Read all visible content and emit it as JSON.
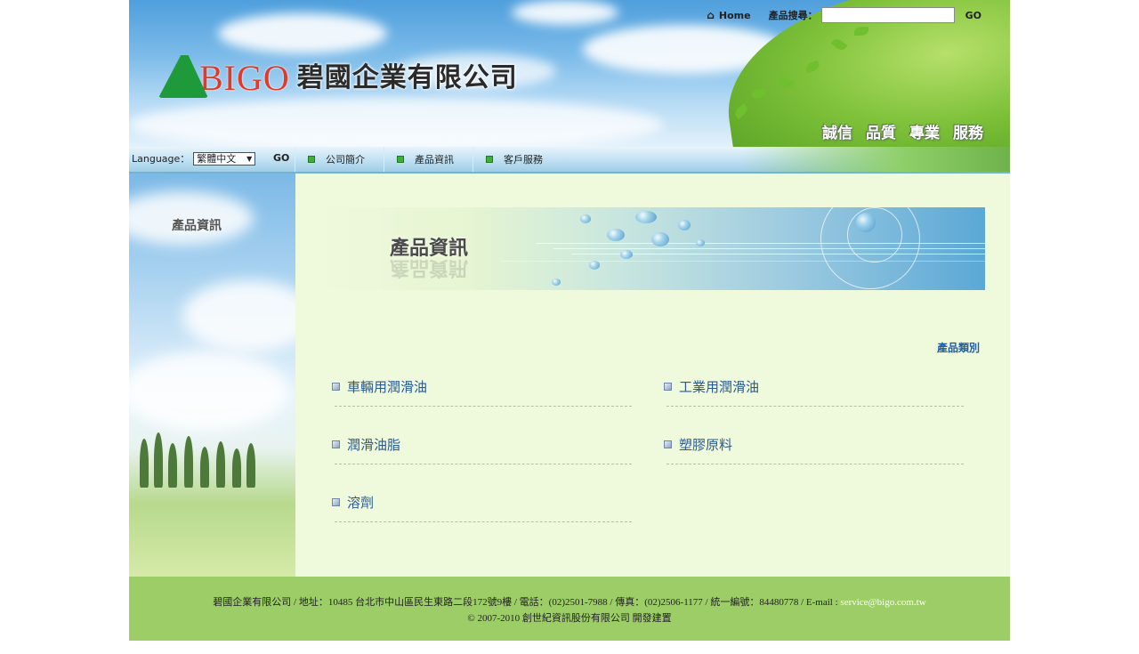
{
  "header": {
    "logo_text": "BIGO",
    "company_name": "碧國企業有限公司",
    "home_label": "Home",
    "search_label": "產品搜尋：",
    "search_value": "",
    "search_go": "GO",
    "slogans": [
      "誠信",
      "品質",
      "專業",
      "服務"
    ]
  },
  "navbar": {
    "language_label": "Language：",
    "language_selected": "繁體中文",
    "language_go": "GO",
    "items": [
      {
        "label": "公司簡介"
      },
      {
        "label": "產品資訊"
      },
      {
        "label": "客戶服務"
      }
    ]
  },
  "sidebar": {
    "title": "產品資訊"
  },
  "main": {
    "banner_title": "產品資訊",
    "category_heading": "產品類別",
    "categories": [
      {
        "label": "車輛用潤滑油"
      },
      {
        "label": "工業用潤滑油"
      },
      {
        "label": "潤滑油脂"
      },
      {
        "label": "塑膠原料"
      },
      {
        "label": "溶劑"
      }
    ]
  },
  "footer": {
    "line1": "碧國企業有限公司 / 地址：10485 台北市中山區民生東路二段172號9樓 / 電話：(02)2501-7988 / 傳真：(02)2506-1177 / 統一編號：84480778 / E-mail :",
    "email": "service@bigo.com.tw",
    "line2": "© 2007-2010 創世紀資訊股份有限公司 開發建置"
  },
  "colors": {
    "footer_bg": "#9ccd66",
    "main_bg": "#eff9dc",
    "link_blue": "#2a5a93",
    "nav_bullet": "#3fae3a"
  }
}
